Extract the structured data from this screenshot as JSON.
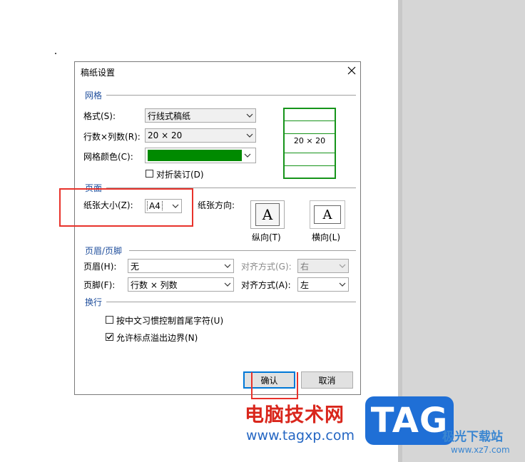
{
  "dialog": {
    "title": "稿纸设置",
    "grid": {
      "section": "网格",
      "format_label": "格式(S):",
      "format_value": "行线式稿纸",
      "rowscols_label": "行数×列数(R):",
      "rowscols_value": "20 × 20",
      "color_label": "网格颜色(C):",
      "color_value": "#008a00",
      "fold_label": "对折装订(D)",
      "preview_text": "20 × 20"
    },
    "page": {
      "section": "页面",
      "size_label": "纸张大小(Z):",
      "size_value": "A4",
      "orientation_label": "纸张方向:",
      "portrait_label": "纵向(T)",
      "landscape_label": "横向(L)"
    },
    "header_footer": {
      "section": "页眉/页脚",
      "header_label": "页眉(H):",
      "header_value": "无",
      "header_align_label": "对齐方式(G):",
      "header_align_value": "右",
      "footer_label": "页脚(F):",
      "footer_value": "行数 × 列数",
      "footer_align_label": "对齐方式(A):",
      "footer_align_value": "左"
    },
    "wrap": {
      "section": "换行",
      "option1_label": "按中文习惯控制首尾字符(U)",
      "option2_label": "允许标点溢出边界(N)"
    },
    "ok_label": "确认",
    "cancel_label": "取消"
  },
  "watermark": {
    "site_name": "电脑技术网",
    "url": "www.tagxp.com",
    "tag": "TAG",
    "side_text": "极光下载站",
    "side_url": "www.xz7.com"
  }
}
